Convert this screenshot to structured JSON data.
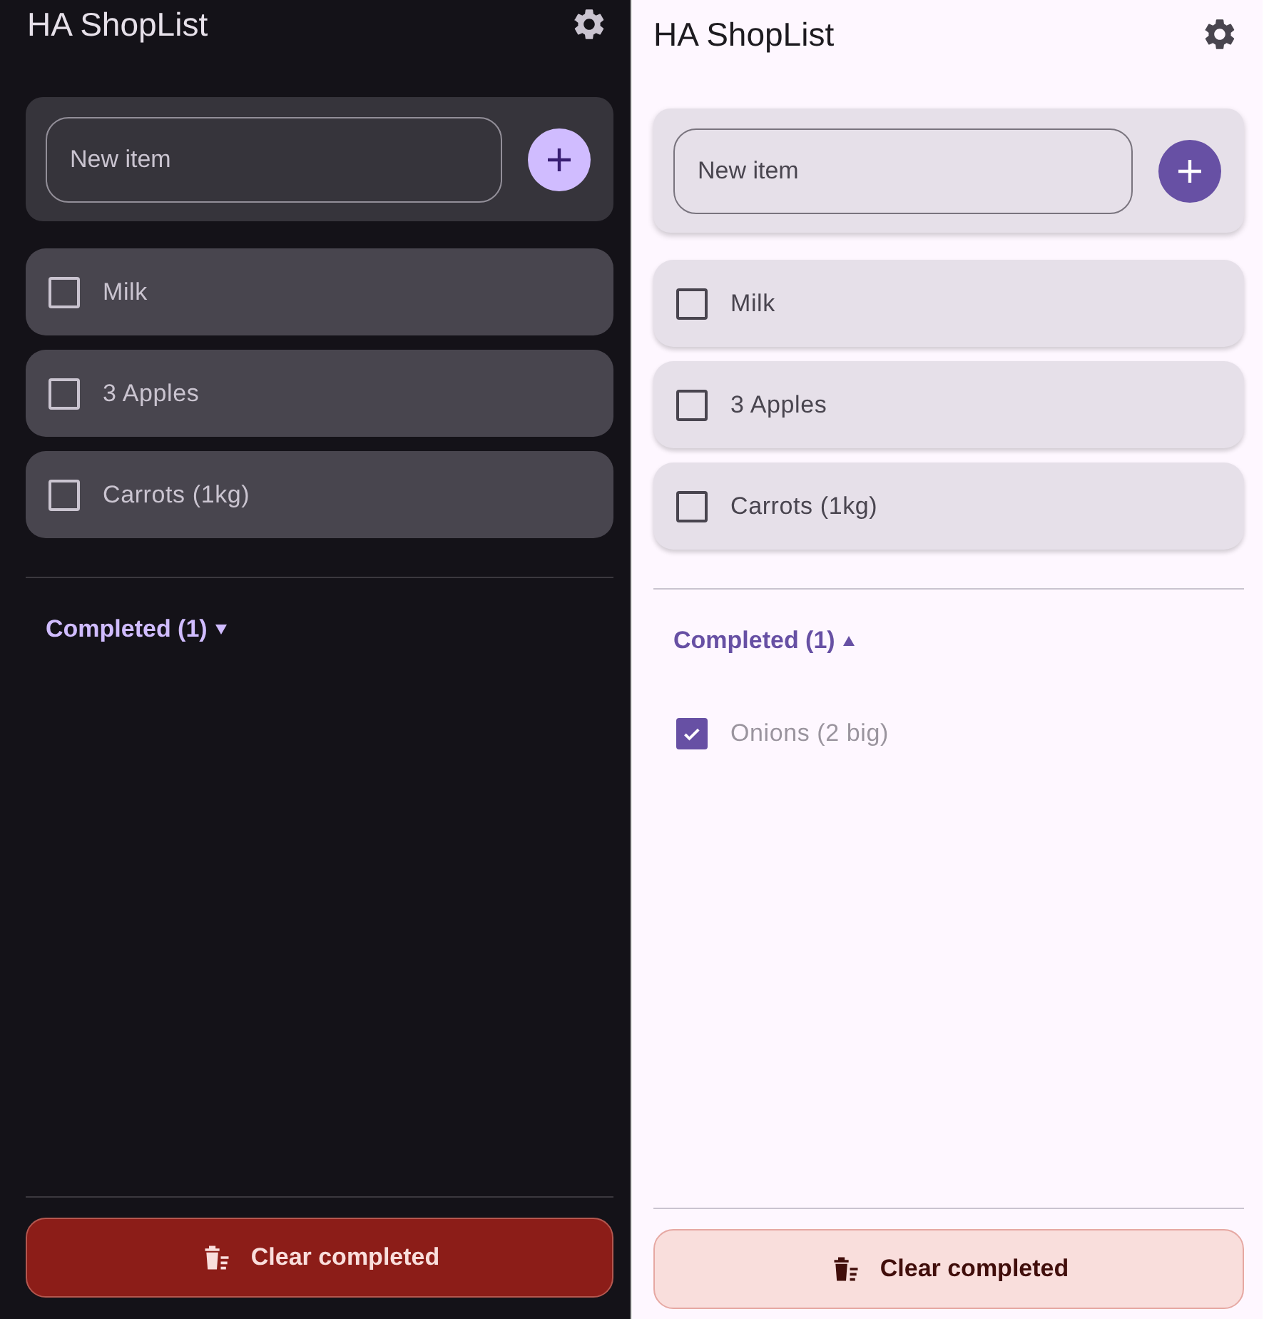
{
  "panels": [
    {
      "kind": "dark",
      "title": "HA ShopList",
      "new_item": {
        "placeholder": "New item"
      },
      "items": [
        {
          "label": "Milk",
          "checked": false
        },
        {
          "label": "3 Apples",
          "checked": false
        },
        {
          "label": "Carrots (1kg)",
          "checked": false
        }
      ],
      "completed": {
        "label": "Completed (1)",
        "expanded": false
      },
      "clear_button": "Clear completed"
    },
    {
      "kind": "light",
      "title": "HA ShopList",
      "new_item": {
        "placeholder": "New item"
      },
      "items": [
        {
          "label": "Milk",
          "checked": false
        },
        {
          "label": "3 Apples",
          "checked": false
        },
        {
          "label": "Carrots (1kg)",
          "checked": false
        }
      ],
      "completed": {
        "label": "Completed (1)",
        "expanded": true,
        "items": [
          {
            "label": "Onions (2 big)",
            "checked": true
          }
        ]
      },
      "clear_button": "Clear completed"
    }
  ]
}
